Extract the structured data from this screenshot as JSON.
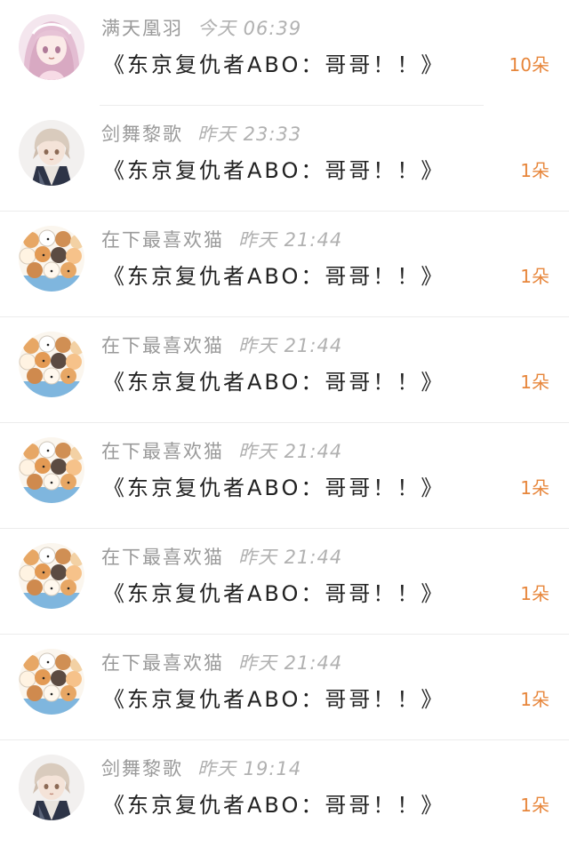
{
  "colors": {
    "count_accent": "#e7863b",
    "meta_text": "#9a9a9a",
    "title_text": "#222222",
    "divider": "#ececec"
  },
  "rows": [
    {
      "avatar_icon": "anime-girl-pink-avatar",
      "name": "满天凰羽",
      "time": "今天 06:39",
      "title": "《东京复仇者ABO：哥哥！！》",
      "count": "10朵"
    },
    {
      "avatar_icon": "anime-boy-avatar",
      "name": "剑舞黎歌",
      "time": "昨天 23:33",
      "title": "《东京复仇者ABO：哥哥！！》",
      "count": "1朵"
    },
    {
      "avatar_icon": "cats-pile-avatar",
      "name": "在下最喜欢猫",
      "time": "昨天 21:44",
      "title": "《东京复仇者ABO：哥哥！！》",
      "count": "1朵"
    },
    {
      "avatar_icon": "cats-pile-avatar",
      "name": "在下最喜欢猫",
      "time": "昨天 21:44",
      "title": "《东京复仇者ABO：哥哥！！》",
      "count": "1朵"
    },
    {
      "avatar_icon": "cats-pile-avatar",
      "name": "在下最喜欢猫",
      "time": "昨天 21:44",
      "title": "《东京复仇者ABO：哥哥！！》",
      "count": "1朵"
    },
    {
      "avatar_icon": "cats-pile-avatar",
      "name": "在下最喜欢猫",
      "time": "昨天 21:44",
      "title": "《东京复仇者ABO：哥哥！！》",
      "count": "1朵"
    },
    {
      "avatar_icon": "cats-pile-avatar",
      "name": "在下最喜欢猫",
      "time": "昨天 21:44",
      "title": "《东京复仇者ABO：哥哥！！》",
      "count": "1朵"
    },
    {
      "avatar_icon": "anime-boy-avatar",
      "name": "剑舞黎歌",
      "time": "昨天 19:14",
      "title": "《东京复仇者ABO：哥哥！！》",
      "count": "1朵"
    }
  ]
}
